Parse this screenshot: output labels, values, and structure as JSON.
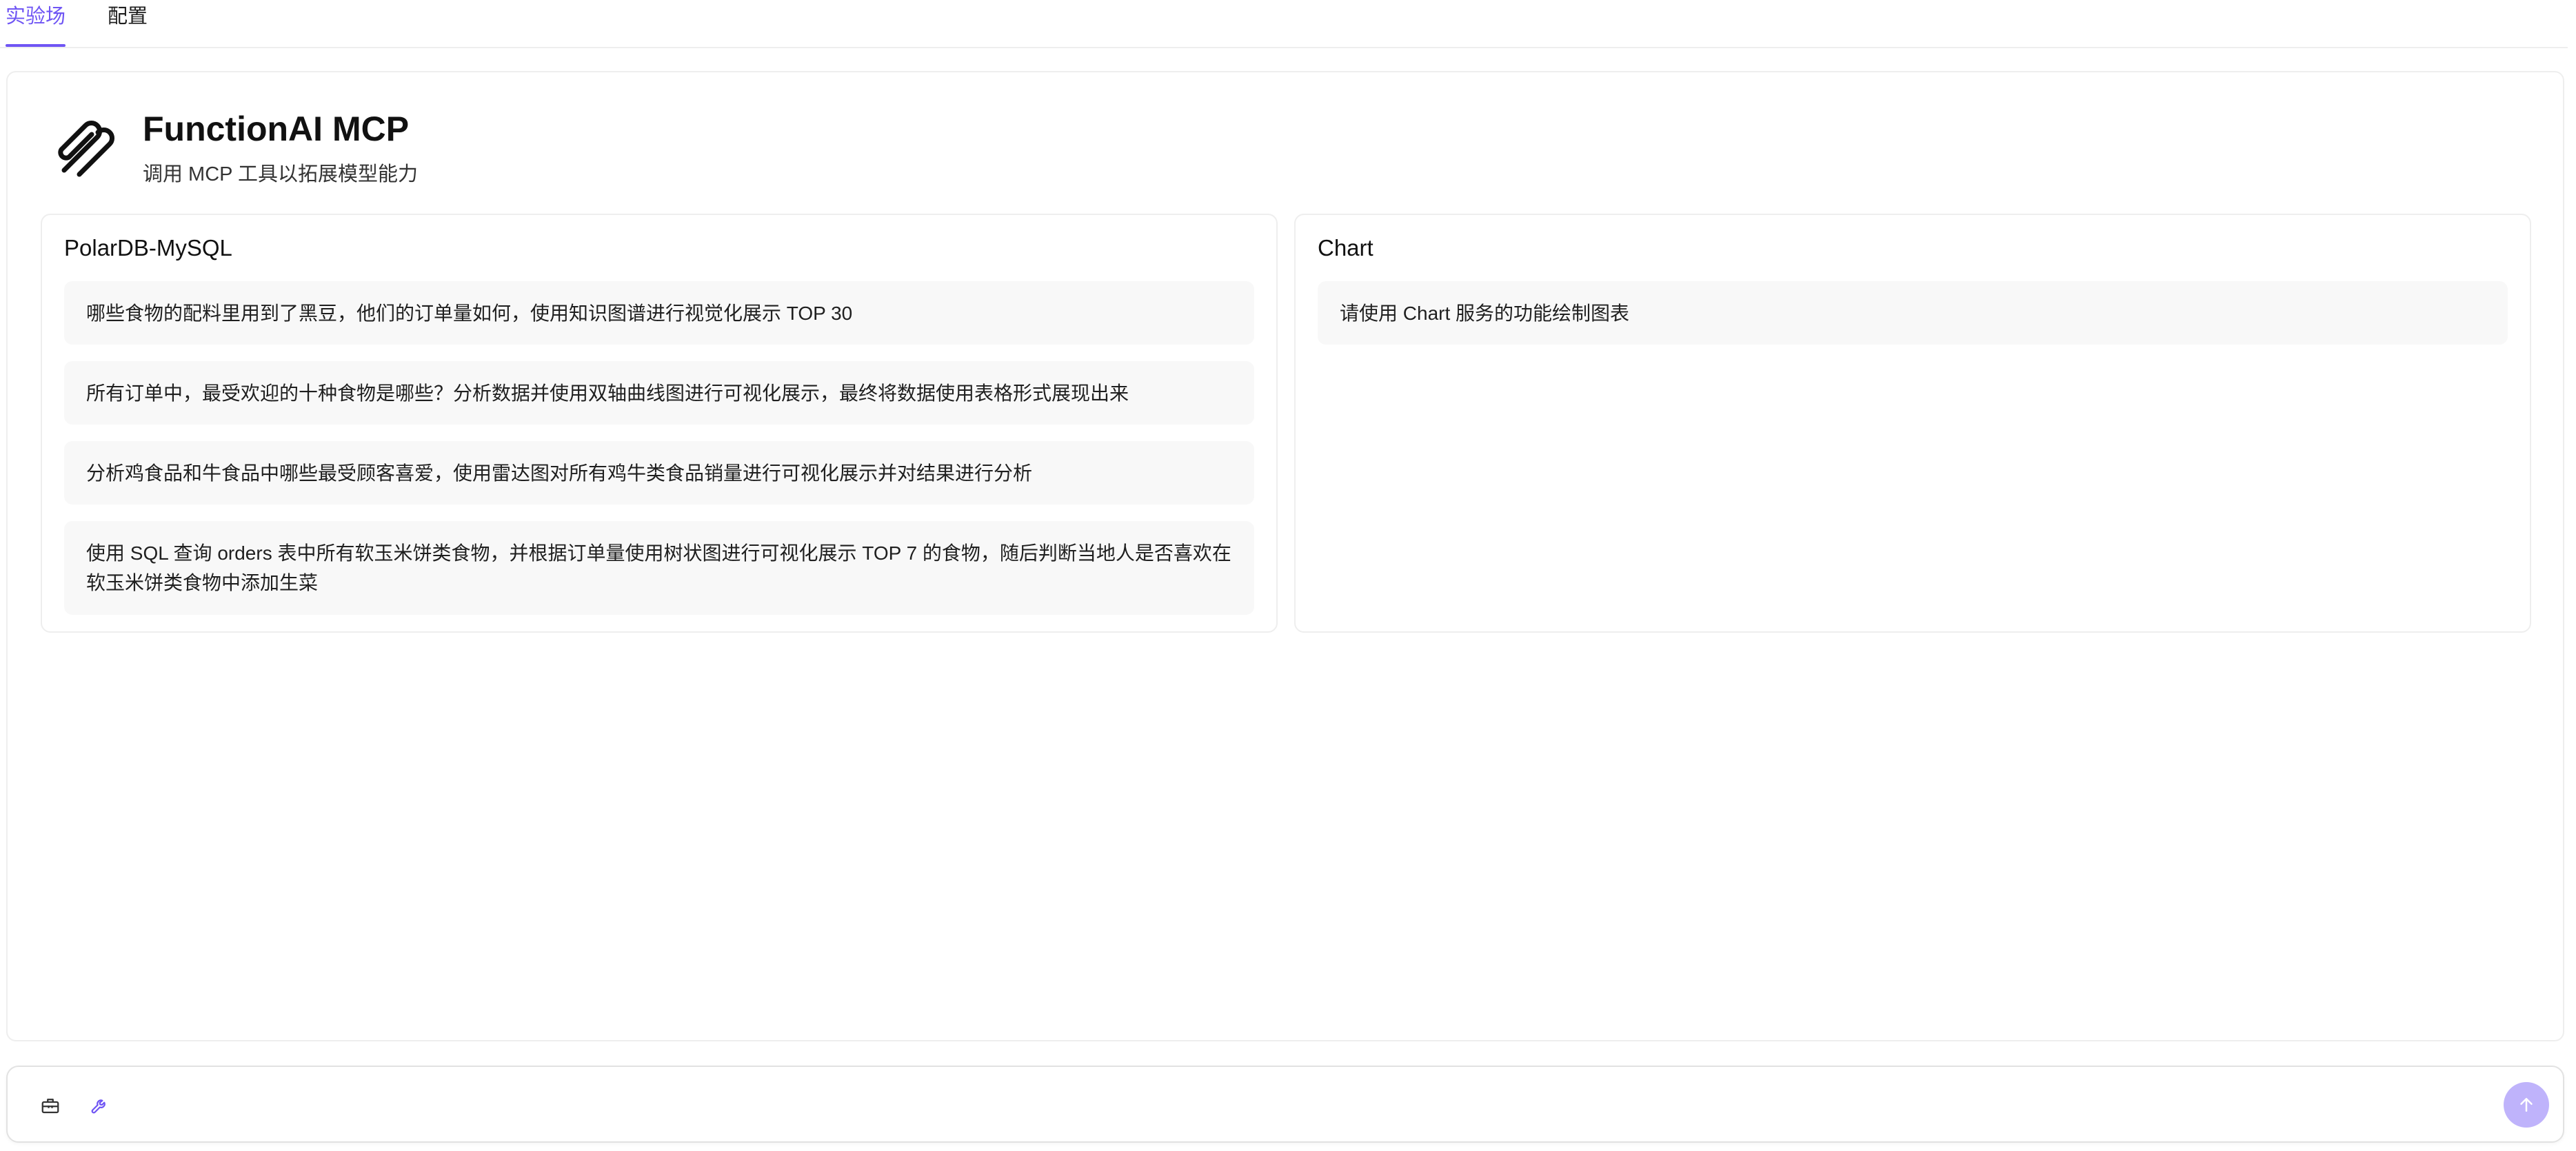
{
  "tabs": [
    {
      "label": "实验场",
      "active": true
    },
    {
      "label": "配置",
      "active": false
    }
  ],
  "header": {
    "title": "FunctionAI MCP",
    "subtitle": "调用 MCP 工具以拓展模型能力",
    "logo_icon": "paperclip-icon"
  },
  "cards": [
    {
      "title": "PolarDB-MySQL",
      "prompts": [
        "哪些食物的配料里用到了黑豆，他们的订单量如何，使用知识图谱进行视觉化展示 TOP 30",
        "所有订单中，最受欢迎的十种食物是哪些？分析数据并使用双轴曲线图进行可视化展示，最终将数据使用表格形式展现出来",
        "分析鸡食品和牛食品中哪些最受顾客喜爱，使用雷达图对所有鸡牛类食品销量进行可视化展示并对结果进行分析",
        "使用 SQL 查询 orders 表中所有软玉米饼类食物，并根据订单量使用树状图进行可视化展示 TOP 7 的食物，随后判断当地人是否喜欢在软玉米饼类食物中添加生菜"
      ]
    },
    {
      "title": "Chart",
      "prompts": [
        "请使用 Chart 服务的功能绘制图表"
      ]
    }
  ],
  "input_bar": {
    "placeholder": "",
    "tools": [
      "toolbox-icon",
      "wrench-icon"
    ],
    "send_icon": "arrow-up-icon"
  },
  "colors": {
    "accent": "#6f55f4",
    "send_button": "#bfb3fb",
    "prompt_bg": "#f8f8f8",
    "border": "#eeeeee"
  }
}
